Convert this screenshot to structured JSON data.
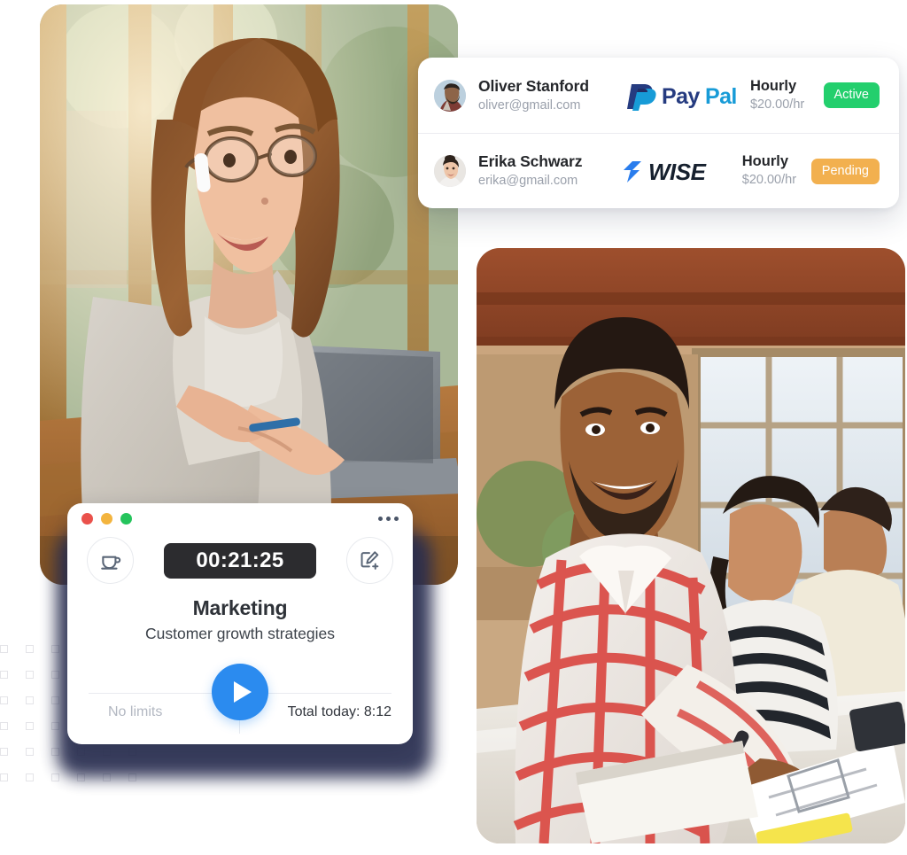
{
  "payment_card": {
    "name": "payments-list-card",
    "rows": [
      {
        "avatar_name": "avatar-oliver-stanford",
        "person_name": "Oliver Stanford",
        "email": "oliver@gmail.com",
        "logo": "paypal-logo",
        "logo_text_dark": "Pay",
        "logo_text_light": "Pal",
        "rate_type": "Hourly",
        "rate_amount": "$20.00/hr",
        "status": "Active",
        "status_color": "#23cf6d"
      },
      {
        "avatar_name": "avatar-erika-schwarz",
        "person_name": "Erika Schwarz",
        "email": "erika@gmail.com",
        "logo": "wise-logo",
        "logo_text": "WISE",
        "rate_type": "Hourly",
        "rate_amount": "$20.00/hr",
        "status": "Pending",
        "status_color": "#f2b04f"
      }
    ]
  },
  "timer_widget": {
    "window_controls": {
      "close": "close-traffic-light",
      "minimize": "minimize-traffic-light",
      "maximize": "maximize-traffic-light",
      "close_color": "#ea514b",
      "minimize_color": "#f3b43e",
      "maximize_color": "#25c45c"
    },
    "more_menu": "more-options",
    "break_button": "break-coffee-button",
    "note_button": "add-note-button",
    "elapsed_time": "00:21:25",
    "project": "Marketing",
    "task": "Customer growth strategies",
    "play_button_label": "start-timer",
    "play_button_color": "#2b8bef",
    "limits_label": "No limits",
    "total_today_label": "Total today: 8:12"
  },
  "photos": {
    "left": {
      "name": "photo-woman-at-cafe-laptop",
      "alt": "Smiling woman with long hair and glasses working on a laptop at a cafe window"
    },
    "right": {
      "name": "photo-team-working-together",
      "alt": "Smiling man in red checked shirt writing notes with colleagues at a shared desk"
    }
  },
  "decoration": {
    "dot_grid": "decorative-dot-grid",
    "dot_color": "#ffffff",
    "dot_rows": 6,
    "dot_cols": 6
  }
}
